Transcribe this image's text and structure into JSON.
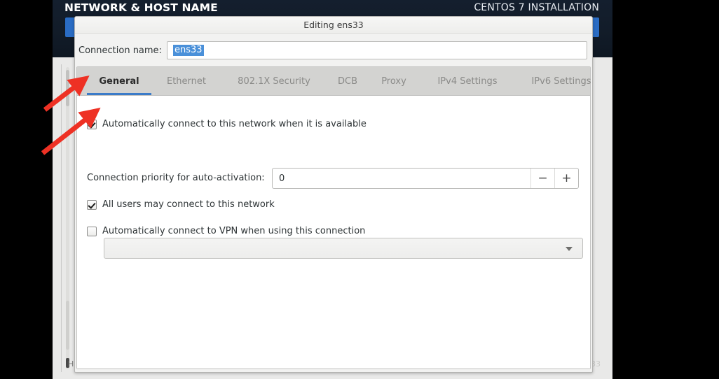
{
  "installer": {
    "title": "NETWORK & HOST NAME",
    "subtitle": "CENTOS 7 INSTALLATION",
    "left_footer": "H",
    "right_footer": "33"
  },
  "dialog": {
    "title": "Editing ens33",
    "connection_name_label": "Connection name:",
    "connection_name_value": "ens33",
    "tabs": [
      {
        "label": "General",
        "active": true
      },
      {
        "label": "Ethernet",
        "active": false
      },
      {
        "label": "802.1X Security",
        "active": false
      },
      {
        "label": "DCB",
        "active": false
      },
      {
        "label": "Proxy",
        "active": false
      },
      {
        "label": "IPv4 Settings",
        "active": false
      },
      {
        "label": "IPv6 Settings",
        "active": false
      }
    ],
    "general": {
      "auto_connect": {
        "label": "Automatically connect to this network when it is available",
        "checked": true
      },
      "priority": {
        "label": "Connection priority for auto-activation:",
        "value": "0",
        "decrement_label": "−",
        "increment_label": "+"
      },
      "all_users": {
        "label": "All users may connect to this network",
        "checked": true
      },
      "auto_vpn": {
        "label": "Automatically connect to VPN when using this connection",
        "checked": false
      },
      "vpn_combo": {
        "value": "",
        "arrow": "chevron-down-icon"
      }
    }
  },
  "colors": {
    "accent": "#3b7bc8",
    "selection": "#4a90d9",
    "header_bg": "#121c29",
    "annotation": "#ee3124"
  }
}
